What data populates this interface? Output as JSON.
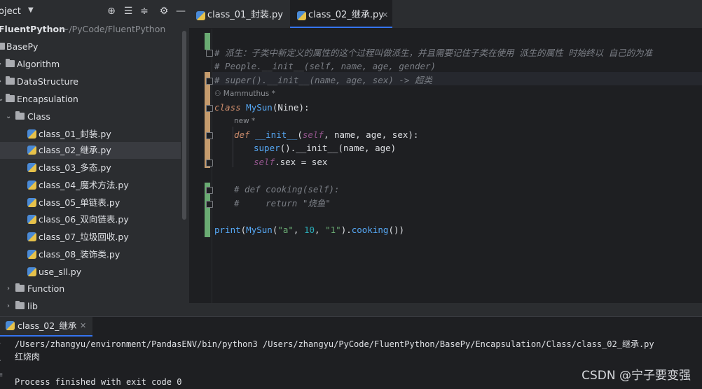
{
  "project": {
    "title": "oject",
    "root": {
      "name": "FluentPython",
      "path": "~/PyCode/FluentPython"
    },
    "items": [
      {
        "label": "BasePy",
        "level": 0,
        "kind": "folder",
        "expanded": true
      },
      {
        "label": "Algorithm",
        "level": 1,
        "kind": "folder",
        "expanded": false
      },
      {
        "label": "DataStructure",
        "level": 1,
        "kind": "folder",
        "expanded": false
      },
      {
        "label": "Encapsulation",
        "level": 1,
        "kind": "folder",
        "expanded": true
      },
      {
        "label": "Class",
        "level": 2,
        "kind": "folder",
        "expanded": true
      },
      {
        "label": "class_01_封装.py",
        "level": 3,
        "kind": "file"
      },
      {
        "label": "class_02_继承.py",
        "level": 3,
        "kind": "file",
        "selected": true
      },
      {
        "label": "class_03_多态.py",
        "level": 3,
        "kind": "file"
      },
      {
        "label": "class_04_魔术方法.py",
        "level": 3,
        "kind": "file"
      },
      {
        "label": "class_05_单链表.py",
        "level": 3,
        "kind": "file"
      },
      {
        "label": "class_06_双向链表.py",
        "level": 3,
        "kind": "file"
      },
      {
        "label": "class_07_垃圾回收.py",
        "level": 3,
        "kind": "file"
      },
      {
        "label": "class_08_装饰类.py",
        "level": 3,
        "kind": "file"
      },
      {
        "label": "use_sll.py",
        "level": 3,
        "kind": "file"
      },
      {
        "label": "Function",
        "level": 2,
        "kind": "folder",
        "expanded": false
      },
      {
        "label": "lib",
        "level": 2,
        "kind": "folder",
        "expanded": false
      }
    ]
  },
  "tabs": [
    {
      "label": "class_01_封装.py",
      "active": false
    },
    {
      "label": "class_02_继承.py",
      "active": true
    }
  ],
  "editor": {
    "hint_author": "Mammuthus *",
    "hint_new": "new *",
    "comment_1": "# 派生：子类中新定义的属性的这个过程叫做派生，并且需要记住子类在使用 派生的属性 时始终以 自己的为准",
    "comment_2": "# People.__init__(self, name, age, gender)",
    "comment_3": "# super().__init__(name, age, sex) -> 超类",
    "class_kw": "class",
    "class_name": "MySun",
    "class_base": "(Nine):",
    "def_kw": "def",
    "init_name": "__init__",
    "init_open": "(",
    "init_self": "self",
    "init_params": ", name, age, sex):",
    "super_call": "super",
    "super_rest": "().__init__(name, age)",
    "self_kw": "self",
    "assign_rest": ".sex = sex",
    "comment_4": "# def cooking(self):",
    "comment_5": "#     return \"烧鱼\"",
    "print_fn": "print",
    "print_open": "(",
    "print_cls": "MySun",
    "print_p1": "(",
    "print_s1": "\"a\"",
    "print_c1": ", ",
    "print_n": "10",
    "print_c2": ", ",
    "print_s2": "\"1\"",
    "print_p2": ").",
    "print_attr": "cooking",
    "print_close": "())"
  },
  "run": {
    "tab_label": "class_02_继承",
    "command": "/Users/zhangyu/environment/PandasENV/bin/python3 /Users/zhangyu/PyCode/FluentPython/BasePy/Encapsulation/Class/class_02_继承.py",
    "output": "红烧肉",
    "exit": "Process finished with exit code 0"
  },
  "watermark": "CSDN @宁子要变强",
  "colors": {
    "accent": "#3574f0",
    "change_modified": "#c59b6d",
    "change_added": "#6aab73"
  }
}
